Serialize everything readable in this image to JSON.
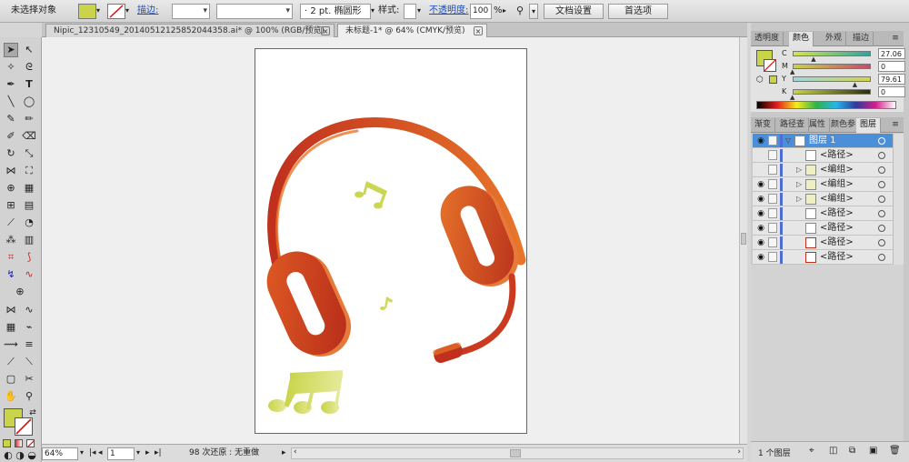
{
  "control_bar": {
    "selection_status": "未选择对象",
    "fill_color": "#c9d44a",
    "stroke_label": "描边:",
    "stroke_weight": "",
    "brush_value": "",
    "brush_size": "2 pt.",
    "brush_shape": "椭圆形",
    "style_label": "样式:",
    "opacity_label": "不透明度:",
    "opacity_value": "100",
    "opacity_unit": "%",
    "doc_setup_button": "文档设置",
    "preferences_button": "首选项"
  },
  "document_tabs": [
    {
      "label": "Nipic_12310549_20140512125852044358.ai* @ 100% (RGB/预览)",
      "active": false
    },
    {
      "label": "未标题-1* @ 64% (CMYK/预览)",
      "active": true
    }
  ],
  "status_bar": {
    "zoom": "64%",
    "page": "1",
    "undo_status": "98 次还原 : 无重做"
  },
  "color_panel": {
    "tabs": [
      "透明度",
      "颜色",
      "外观",
      "描边"
    ],
    "active_tab": "颜色",
    "channels": [
      {
        "label": "C",
        "value": "27.06",
        "fraction": 0.27
      },
      {
        "label": "M",
        "value": "0",
        "fraction": 0.0
      },
      {
        "label": "Y",
        "value": "79.61",
        "fraction": 0.8
      },
      {
        "label": "K",
        "value": "0",
        "fraction": 0.0
      }
    ],
    "swatch_color": "#c9d44a"
  },
  "layers_panel": {
    "tabs": [
      "渐变",
      "路径查",
      "属性",
      "颜色参",
      "图层"
    ],
    "active_tab": "图层",
    "rows": [
      {
        "name": "图层 1",
        "level": 0,
        "expanded": true,
        "active": true,
        "visible": true
      },
      {
        "name": "<路径>",
        "level": 1,
        "expanded": false,
        "active": false,
        "visible": false
      },
      {
        "name": "<编组>",
        "level": 1,
        "expandable": true,
        "active": false,
        "visible": false
      },
      {
        "name": "<编组>",
        "level": 1,
        "expandable": true,
        "active": false,
        "visible": true
      },
      {
        "name": "<编组>",
        "level": 1,
        "expandable": true,
        "active": false,
        "visible": true
      },
      {
        "name": "<路径>",
        "level": 1,
        "active": false,
        "visible": true
      },
      {
        "name": "<路径>",
        "level": 1,
        "active": false,
        "visible": true
      },
      {
        "name": "<路径>",
        "level": 1,
        "active": false,
        "visible": true
      },
      {
        "name": "<路径>",
        "level": 1,
        "active": false,
        "visible": true
      }
    ],
    "footer_label": "1 个图层"
  },
  "artwork": {
    "headphone_dark": "#c0301d",
    "headphone_light": "#e8752a",
    "note_color": "#c9d44a"
  }
}
